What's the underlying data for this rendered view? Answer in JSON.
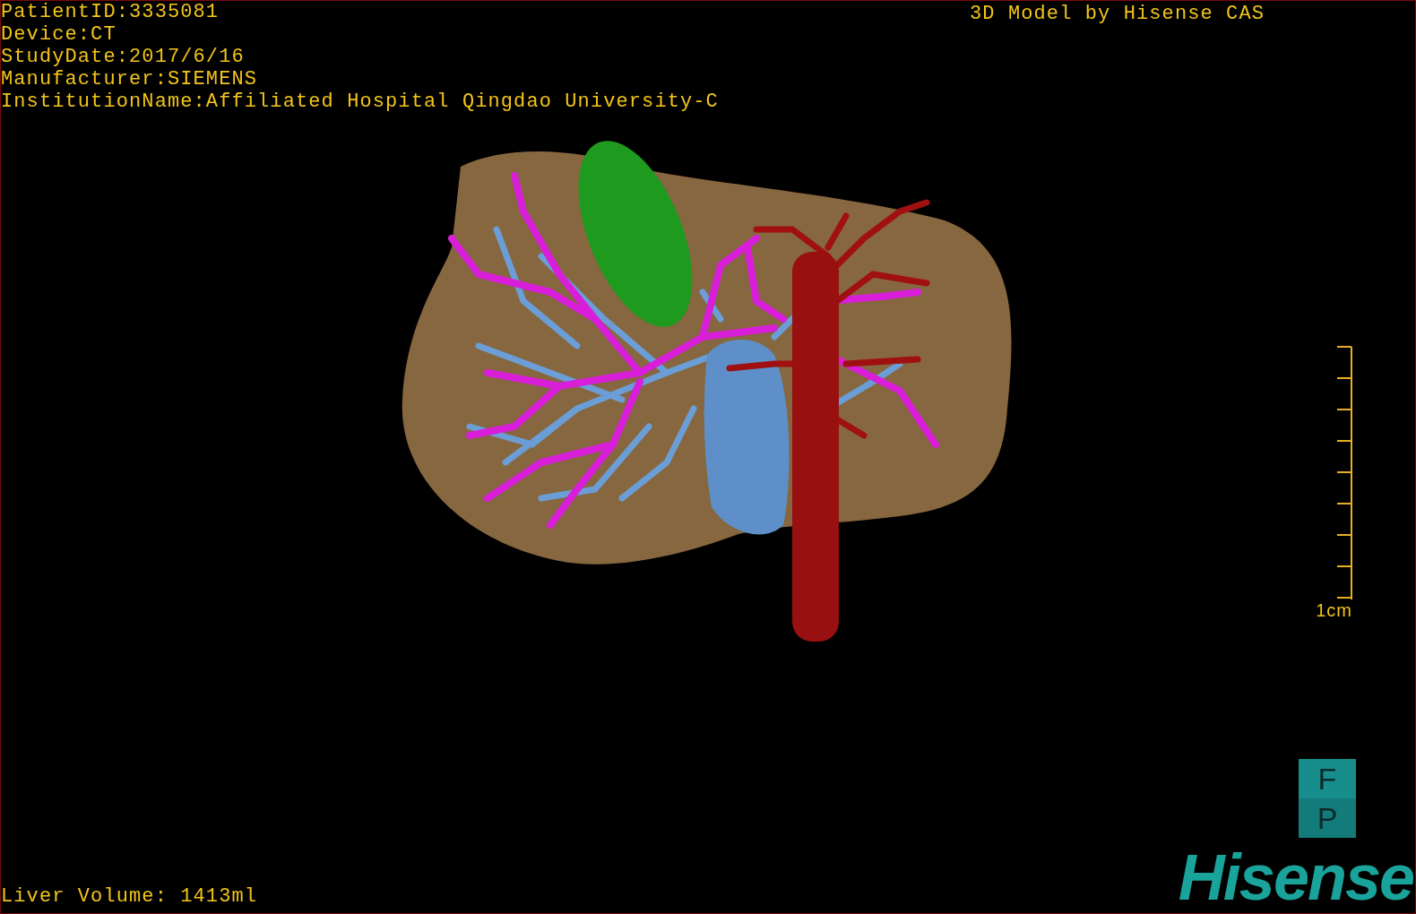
{
  "patient_info": [
    "PatientID:3335081",
    "Device:CT",
    "StudyDate:2017/6/16",
    "Manufacturer:SIEMENS",
    "InstitutionName:Affiliated Hospital Qingdao University-C"
  ],
  "header_title": "3D Model by Hisense CAS",
  "scale_bar": {
    "label": "1cm"
  },
  "liver_volume": "Liver Volume: 1413ml",
  "orientation_cube": {
    "faces": [
      "F",
      "P"
    ]
  },
  "logo": "Hisense"
}
